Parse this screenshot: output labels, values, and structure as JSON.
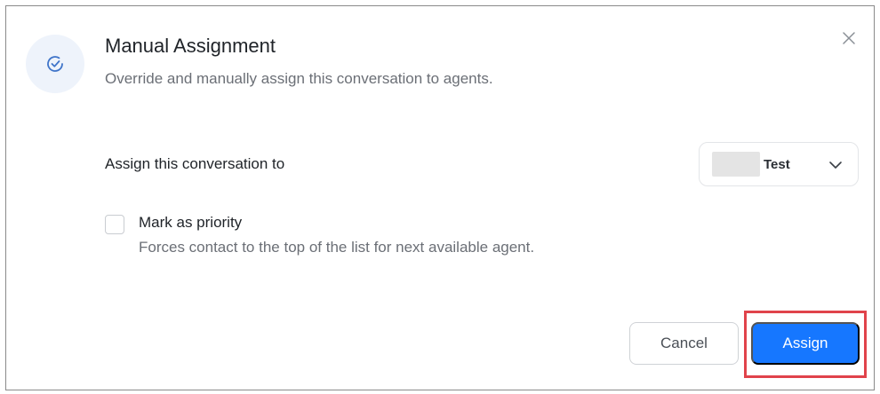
{
  "dialog": {
    "title": "Manual Assignment",
    "subtitle": "Override and manually assign this conversation to agents.",
    "header_icon": "check-circle-icon",
    "close_icon": "close-icon"
  },
  "assignment": {
    "label": "Assign this conversation to",
    "selected_agent": "Test",
    "chevron_icon": "chevron-down-icon"
  },
  "priority": {
    "label": "Mark as priority",
    "description": "Forces contact to the top of the list for next available agent.",
    "checked": false
  },
  "footer": {
    "cancel_label": "Cancel",
    "assign_label": "Assign"
  },
  "colors": {
    "accent": "#1677ff",
    "highlight": "#e0434b",
    "icon_bg": "#eef3fb"
  }
}
